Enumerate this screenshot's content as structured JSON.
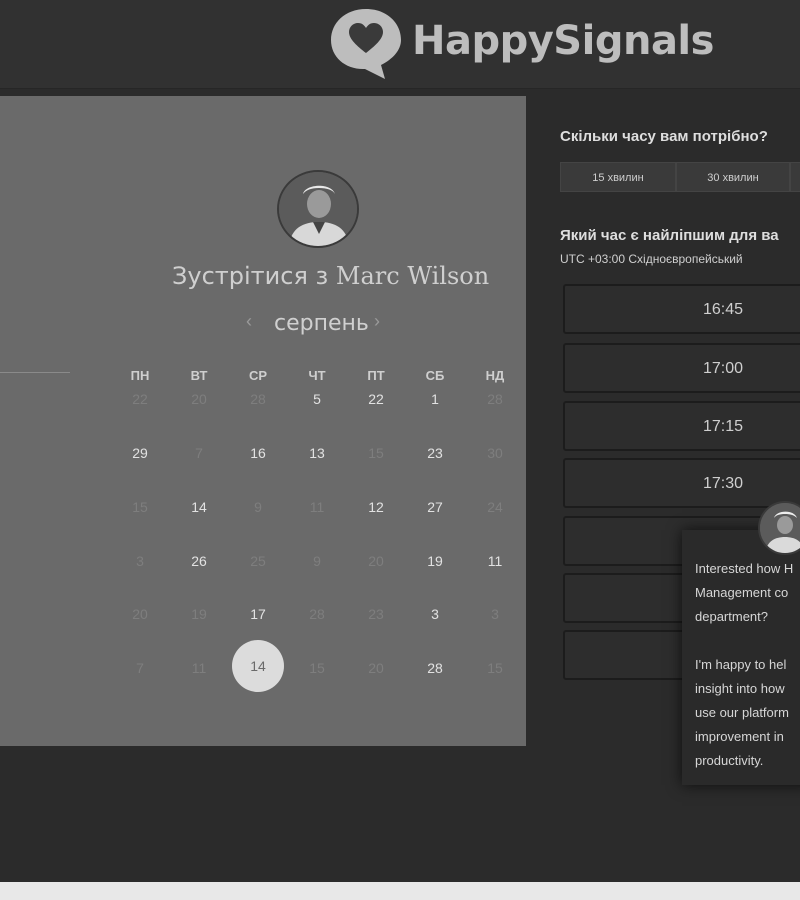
{
  "header": {
    "brand": "HappySignals",
    "logo_icon": "heart-speech-bubble-icon"
  },
  "calendar": {
    "meet_prefix": "Зустрітися з",
    "host_name": "Marc Wilson",
    "month": "серпень",
    "prev_icon": "chevron-left-icon",
    "next_icon": "chevron-right-icon",
    "weekdays": [
      "ПН",
      "ВТ",
      "СР",
      "ЧТ",
      "ПТ",
      "СБ",
      "НД"
    ],
    "weeks": [
      [
        "22",
        "20",
        "28",
        "5",
        "22",
        "1",
        "28"
      ],
      [
        "29",
        "7",
        "16",
        "13",
        "15",
        "23",
        "30"
      ],
      [
        "15",
        "14",
        "9",
        "11",
        "12",
        "27",
        "24"
      ],
      [
        "3",
        "26",
        "25",
        "9",
        "20",
        "19",
        "11"
      ],
      [
        "20",
        "19",
        "17",
        "28",
        "23",
        "3",
        "3"
      ],
      [
        "7",
        "11",
        "14",
        "15",
        "20",
        "28",
        "15"
      ]
    ],
    "selected": "14"
  },
  "duration": {
    "question": "Скільки часу вам потрібно?",
    "options": [
      "15 хвилин",
      "30 хвилин",
      ""
    ]
  },
  "time": {
    "question": "Який час є найліпшим для ва",
    "timezone": "UTC +03:00 Східноєвропейський",
    "slots": [
      "16:45",
      "17:00",
      "17:15",
      "17:30",
      "",
      "",
      ""
    ]
  },
  "chat": {
    "message": "Interested how H\nManagement co\ndepartment?\n\nI'm happy to hel\ninsight into how\nuse our platform\nimprovement in\nproductivity."
  }
}
